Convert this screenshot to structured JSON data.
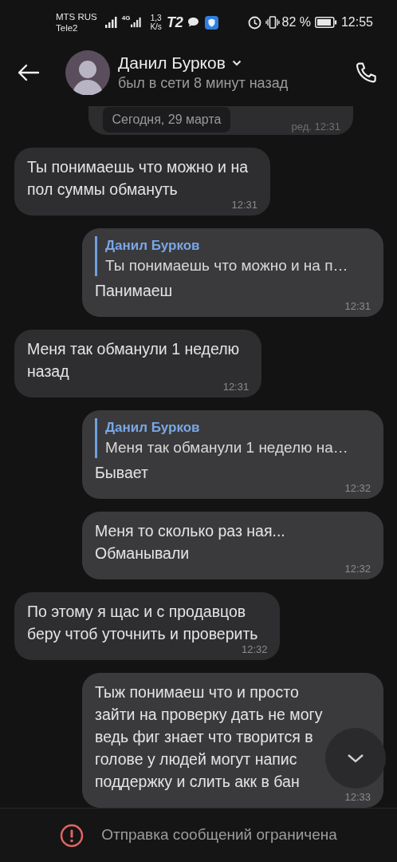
{
  "status_bar": {
    "carrier_1": "MTS RUS",
    "carrier_2": "Tele2",
    "network": "4G",
    "speed_value": "1,3",
    "speed_unit": "K/s",
    "operator_logo": "T2",
    "battery": "82 %",
    "time": "12:55"
  },
  "header": {
    "name": "Данил Бурков",
    "status": "был в сети 8 минут назад"
  },
  "partial_message": {
    "time": "ред. 12:31"
  },
  "date_label": "Сегодня, 29 марта",
  "messages": [
    {
      "kind": "incoming",
      "text": "Ты понимаешь что можно и на\nпол суммы обмануть",
      "time": "12:31"
    },
    {
      "kind": "outgoing",
      "reply": {
        "author": "Данил Бурков",
        "text": "Ты понимаешь что можно и на п…"
      },
      "text": "Панимаеш",
      "time": "12:31"
    },
    {
      "kind": "incoming",
      "text": "Меня так обманули 1 неделю\nназад",
      "time": "12:31"
    },
    {
      "kind": "outgoing",
      "reply": {
        "author": "Данил Бурков",
        "text": "Меня так обманули 1 неделю на…"
      },
      "text": "Бывает",
      "time": "12:32"
    },
    {
      "kind": "outgoing",
      "text": "Меня то сколько раз ная...\nОбманывали",
      "time": "12:32"
    },
    {
      "kind": "incoming",
      "text": "По этому я щас и с продавцов\nберу чтоб уточнить и проверить",
      "time": "12:32"
    },
    {
      "kind": "outgoing",
      "text": "Тыж понимаеш что и просто\nзайти на проверку дать не могу\nведь фиг знает что творится в\nголове у людей могут напис\nподдержку и слить акк в бан",
      "time": "12:33"
    }
  ],
  "notice": "Отправка сообщений ограничена"
}
